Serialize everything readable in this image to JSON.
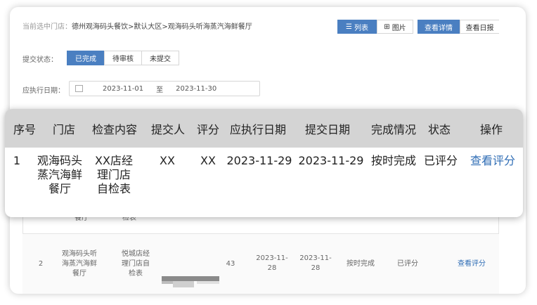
{
  "breadcrumb": {
    "label": "当前选中门店：",
    "path": "德州观海码头餐饮>默认大区>观海码头听海蒸汽海鲜餐厅"
  },
  "toolbar": {
    "list_label": "列表",
    "image_label": "图片",
    "detail_label": "查看详情",
    "daily_label": "查看日报"
  },
  "filters": {
    "status_label": "提交状态：",
    "status_options": [
      "已完成",
      "待审核",
      "未提交"
    ],
    "date_label": "应执行日期：",
    "date_from": "2023-11-01",
    "date_to_sep": "至",
    "date_to": "2023-11-30"
  },
  "bg_table": {
    "row1_tail": {
      "store": "餐厅",
      "content": "检表"
    },
    "row2": {
      "index": "2",
      "store": "观海码头听海蒸汽海鲜餐厅",
      "content": "悦城店经理门店自检表",
      "score": "43",
      "exec_date": "2023-11-28",
      "submit_date": "2023-11-28",
      "completion": "按时完成",
      "status": "已评分",
      "action": "查看评分"
    }
  },
  "overlay": {
    "headers": [
      "序号",
      "门店",
      "检查内容",
      "提交人",
      "评分",
      "应执行日期",
      "提交日期",
      "完成情况",
      "状态",
      "操作"
    ],
    "row": {
      "index": "1",
      "store": "观海码头蒸汽海鲜餐厅",
      "content": "XX店经理门店自检表",
      "submitter": "XX",
      "score": "XX",
      "exec_date": "2023-11-29",
      "submit_date": "2023-11-29",
      "completion": "按时完成",
      "status": "已评分",
      "action": "查看评分"
    }
  },
  "colors": {
    "accent": "#4a7fc1",
    "link": "#2f6db5",
    "header_bg": "#d4d4d4"
  }
}
